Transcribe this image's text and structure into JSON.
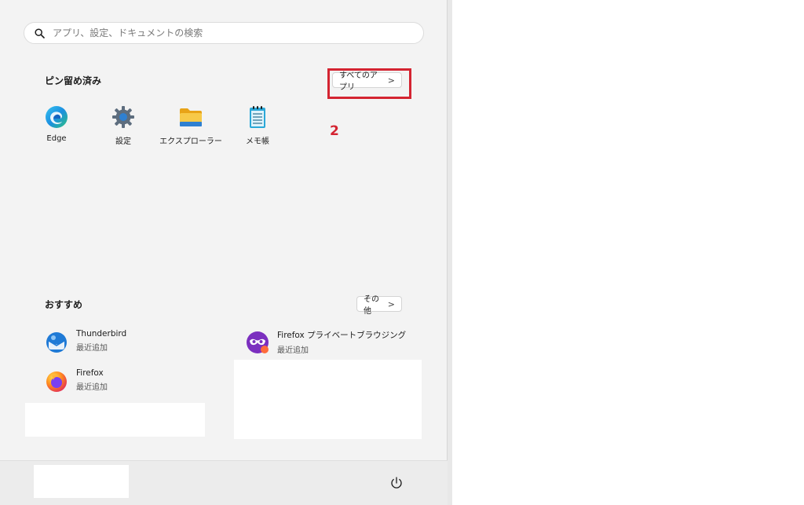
{
  "search": {
    "placeholder": "アプリ、設定、ドキュメントの検索",
    "icon": "search-icon"
  },
  "pinned": {
    "title": "ピン留め済み",
    "all_apps_label": "すべてのアプリ",
    "all_apps_chevron": ">",
    "apps": [
      {
        "label": "Edge",
        "icon": "edge-icon"
      },
      {
        "label": "設定",
        "icon": "settings-gear-icon"
      },
      {
        "label": "エクスプローラー",
        "icon": "folder-icon"
      },
      {
        "label": "メモ帳",
        "icon": "notepad-icon"
      }
    ]
  },
  "annotation": {
    "step": "2",
    "color": "#d42431"
  },
  "recommended": {
    "title": "おすすめ",
    "more_label": "その他",
    "more_chevron": ">",
    "items": [
      {
        "name": "Thunderbird",
        "sub": "最近追加",
        "icon": "thunderbird-icon"
      },
      {
        "name": "Firefox プライベートブラウジング",
        "sub": "最近追加",
        "icon": "firefox-private-icon"
      },
      {
        "name": "Firefox",
        "sub": "最近追加",
        "icon": "firefox-icon"
      }
    ]
  },
  "footer": {
    "power_icon": "power-icon"
  }
}
